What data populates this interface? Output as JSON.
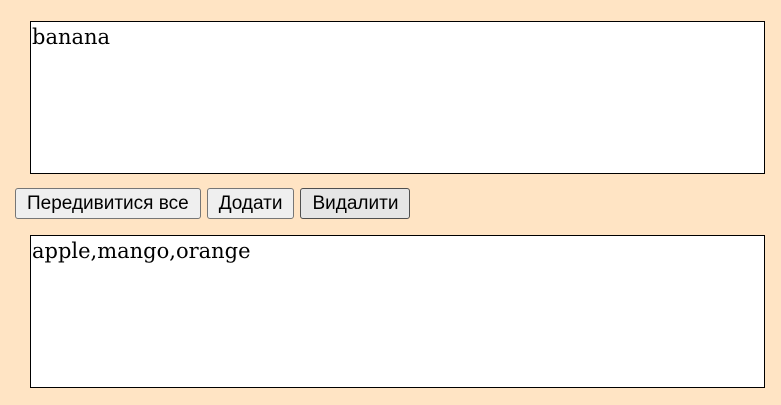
{
  "top_box": {
    "text": "banana"
  },
  "buttons": {
    "view_all": "Передивитися все",
    "add": "Додати",
    "delete": "Видалити"
  },
  "bottom_box": {
    "text": "apple,mango,orange"
  },
  "colors": {
    "background": "#ffe4c4",
    "box_background": "#ffffff",
    "box_border": "#000000"
  }
}
